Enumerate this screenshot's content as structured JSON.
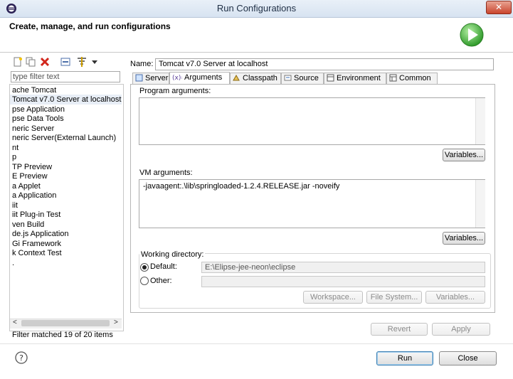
{
  "window": {
    "title": "Run Configurations",
    "close_glyph": "✕"
  },
  "banner": {
    "title": "Create, manage, and run configurations",
    "icon": "run-icon"
  },
  "left": {
    "toolbar_icons": [
      "new-configuration-icon",
      "duplicate-icon",
      "delete-icon",
      "collapse-all-icon",
      "filter-icon",
      "dropdown-icon"
    ],
    "filter_placeholder": "type filter text",
    "tree": [
      "ache Tomcat",
      "Tomcat v7.0 Server at localhost",
      "pse Application",
      "pse Data Tools",
      "neric Server",
      "neric Server(External Launch)",
      "nt",
      "p",
      "TP Preview",
      "E Preview",
      "a Applet",
      "a Application",
      "iit",
      "iit Plug-in Test",
      "ven Build",
      "de.js Application",
      "Gi Framework",
      "k Context Test",
      "."
    ],
    "scroll_left": "<",
    "scroll_right": ">",
    "status": "Filter matched 19 of 20 items"
  },
  "right": {
    "name_label": "Name:",
    "name_value": "Tomcat v7.0 Server at localhost",
    "tabs": [
      "Server",
      "Arguments",
      "Classpath",
      "Source",
      "Environment",
      "Common"
    ],
    "active_tab": "Arguments",
    "program_args_label": "Program arguments:",
    "program_args_value": "",
    "variables_label": "Variables...",
    "vm_args_label": "VM arguments:",
    "vm_args_value": "-javaagent:.\\lib\\springloaded-1.2.4.RELEASE.jar -noveify",
    "working_dir_label": "Working directory:",
    "default_label": "Default:",
    "default_value": "E:\\Elipse-jee-neon\\eclipse",
    "other_label": "Other:",
    "other_value": "",
    "workspace_btn": "Workspace...",
    "filesystem_btn": "File System...",
    "variables_btn_3": "Variables...",
    "revert_btn": "Revert",
    "apply_btn": "Apply"
  },
  "footer": {
    "help_glyph": "?",
    "run_btn": "Run",
    "close_btn": "Close"
  }
}
